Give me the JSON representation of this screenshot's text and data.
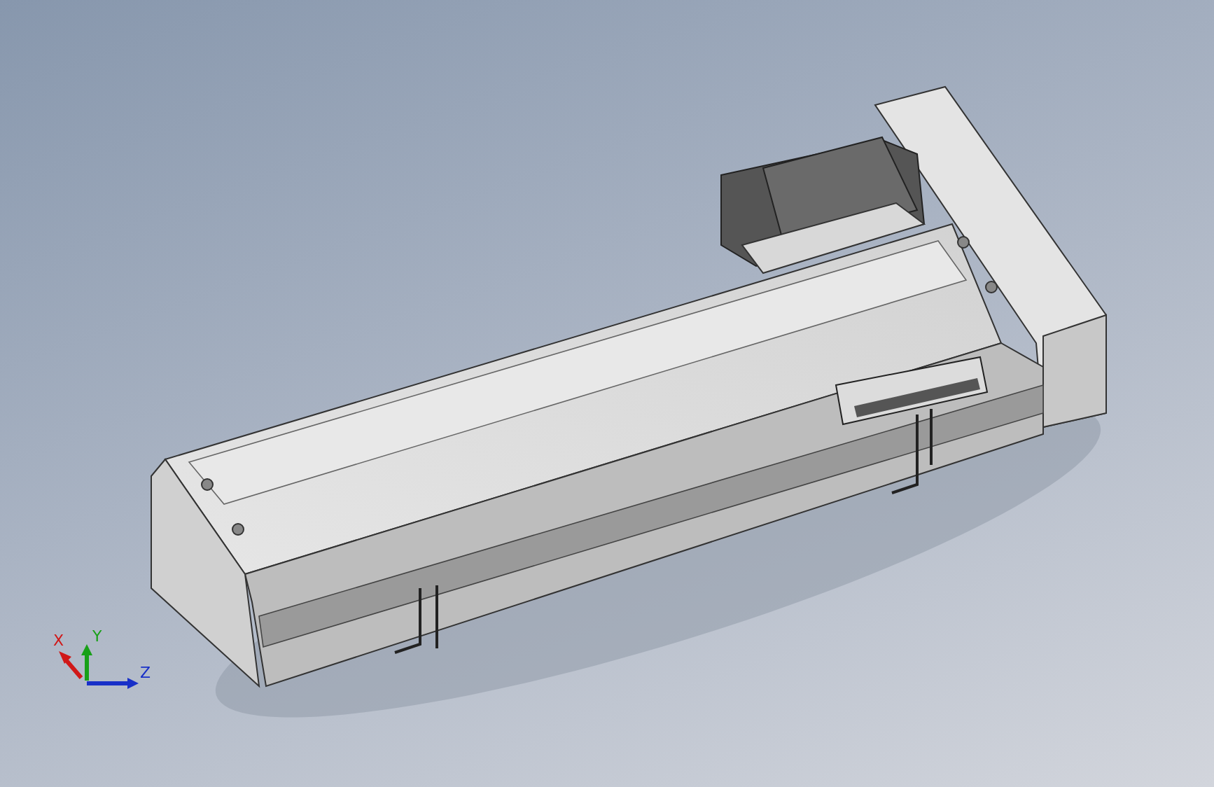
{
  "viewport": {
    "triad": {
      "axes": [
        {
          "label": "X",
          "color": "#d01818"
        },
        {
          "label": "Y",
          "color": "#18a018"
        },
        {
          "label": "Z",
          "color": "#1830c8"
        }
      ]
    }
  }
}
